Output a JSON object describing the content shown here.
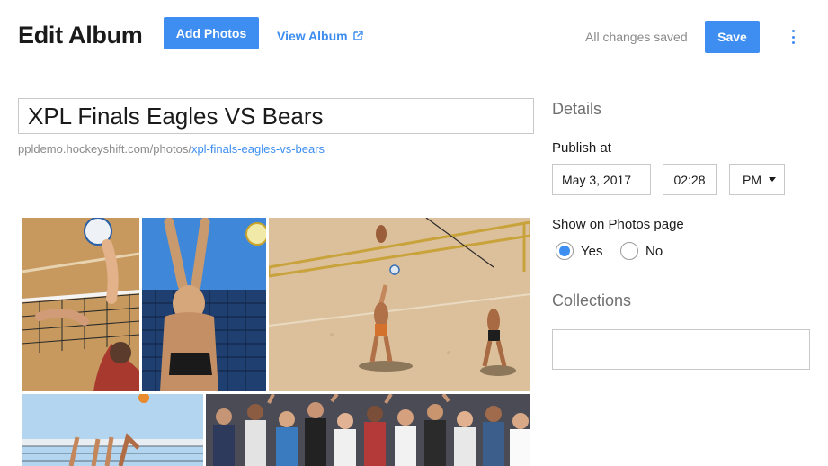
{
  "header": {
    "title": "Edit Album",
    "add_photos_label": "Add Photos",
    "view_album_label": "View Album",
    "status_text": "All changes saved",
    "save_label": "Save"
  },
  "album": {
    "title": "XPL Finals Eagles VS Bears",
    "url_base": "ppldemo.hockeyshift.com/photos/",
    "url_slug": "xpl-finals-eagles-vs-bears"
  },
  "photos": [
    {
      "subject": "indoor volleyball block at net"
    },
    {
      "subject": "beach volleyball player blocking"
    },
    {
      "subject": "beach volleyball aerial view"
    },
    {
      "subject": "volleyball players at net"
    },
    {
      "subject": "crowd cheering in stands"
    }
  ],
  "details": {
    "heading": "Details",
    "publish_label": "Publish at",
    "date_value": "May 3, 2017",
    "time_value": "02:28",
    "ampm_value": "PM",
    "show_label": "Show on Photos page",
    "radio_yes": "Yes",
    "radio_no": "No",
    "selected": "Yes",
    "collections_heading": "Collections",
    "collections_value": ""
  },
  "icons": {
    "external_link": "external-link-icon",
    "more_menu": "more-vert-icon",
    "dropdown": "caret-down-icon"
  },
  "colors": {
    "accent": "#3d8ef0",
    "muted_text": "#8a8a8a",
    "heading_gray": "#707070"
  }
}
